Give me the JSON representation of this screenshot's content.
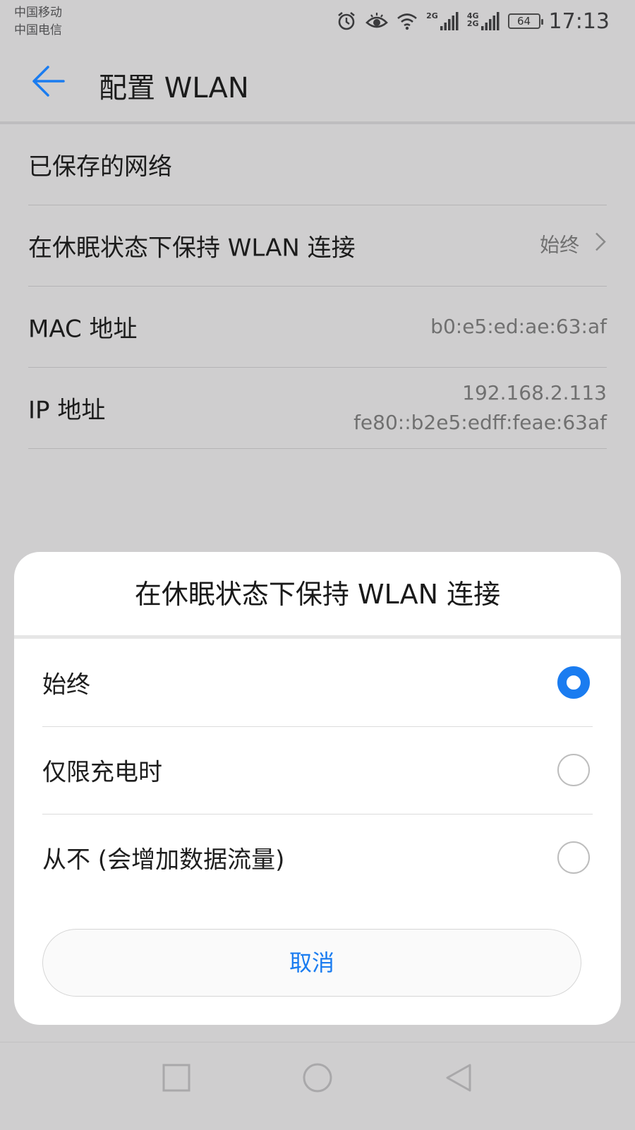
{
  "status_bar": {
    "carrier_1": "中国移动",
    "carrier_2": "中国电信",
    "net_1": "2G",
    "net_2a": "4G",
    "net_2b": "2G",
    "battery": "64",
    "time": "17:13",
    "icons": [
      "alarm-icon",
      "eye-icon",
      "wifi-icon",
      "signal-icon",
      "signal-icon",
      "battery-icon"
    ]
  },
  "app_bar": {
    "title": "配置 WLAN",
    "back_icon": "back-arrow-icon"
  },
  "settings": [
    {
      "label": "已保存的网络",
      "value": ""
    },
    {
      "label": "在休眠状态下保持 WLAN 连接",
      "value": "始终"
    },
    {
      "label": "MAC 地址",
      "value": "b0:e5:ed:ae:63:af"
    },
    {
      "label": "IP 地址",
      "value_line1": "192.168.2.113",
      "value_line2": "fe80::b2e5:edff:feae:63af"
    }
  ],
  "dialog": {
    "title": "在休眠状态下保持 WLAN 连接",
    "options": [
      {
        "label": "始终",
        "selected": true
      },
      {
        "label": "仅限充电时",
        "selected": false
      },
      {
        "label": "从不 (会增加数据流量)",
        "selected": false
      }
    ],
    "cancel": "取消"
  },
  "colors": {
    "accent": "#1a7cf0",
    "background_dimmed": "#cfcecf",
    "dialog_bg": "#ffffff"
  },
  "nav_bar": [
    "recents-square-icon",
    "home-circle-icon",
    "back-triangle-icon"
  ]
}
